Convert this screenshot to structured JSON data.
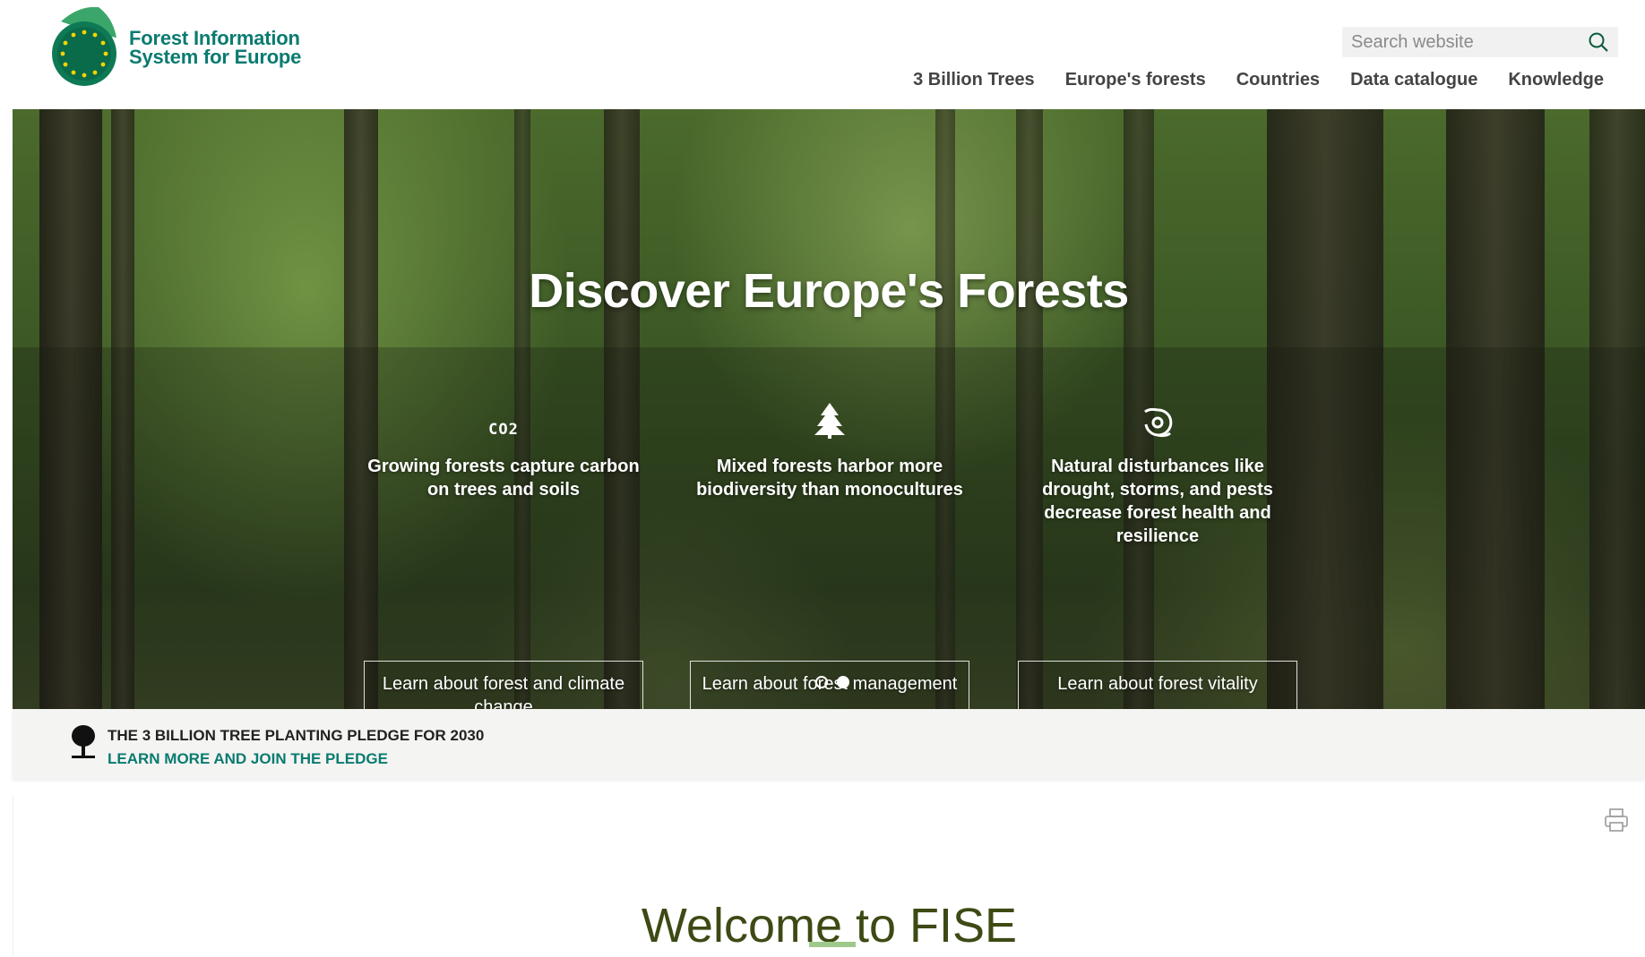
{
  "header": {
    "logo_line1": "Forest Information",
    "logo_line2": "System for Europe",
    "search_placeholder": "Search website",
    "nav": [
      {
        "label": "3 Billion Trees"
      },
      {
        "label": "Europe's forests"
      },
      {
        "label": "Countries"
      },
      {
        "label": "Data catalogue"
      },
      {
        "label": "Knowledge"
      }
    ]
  },
  "hero": {
    "title": "Discover Europe's Forests",
    "features": [
      {
        "icon": "co2-icon",
        "icon_text": "CO2",
        "text": "Growing forests capture carbon on trees and soils",
        "button": "Learn about forest and climate change"
      },
      {
        "icon": "tree-icon",
        "text": "Mixed forests harbor more biodiversity than monocultures",
        "button": "Learn about forest management"
      },
      {
        "icon": "storm-icon",
        "text": "Natural disturbances like drought, storms, and pests decrease forest health and resilience",
        "button": "Learn about forest vitality"
      }
    ],
    "carousel": {
      "slides": 2,
      "active": 2
    }
  },
  "pledge": {
    "title": "THE 3 BILLION TREE PLANTING PLEDGE FOR 2030",
    "link": "LEARN MORE AND JOIN THE PLEDGE"
  },
  "main": {
    "title": "Welcome to FISE"
  },
  "colors": {
    "brand_green": "#0a7b70",
    "title_olive": "#3d4a14",
    "accent_light_green": "#9fc98a"
  }
}
